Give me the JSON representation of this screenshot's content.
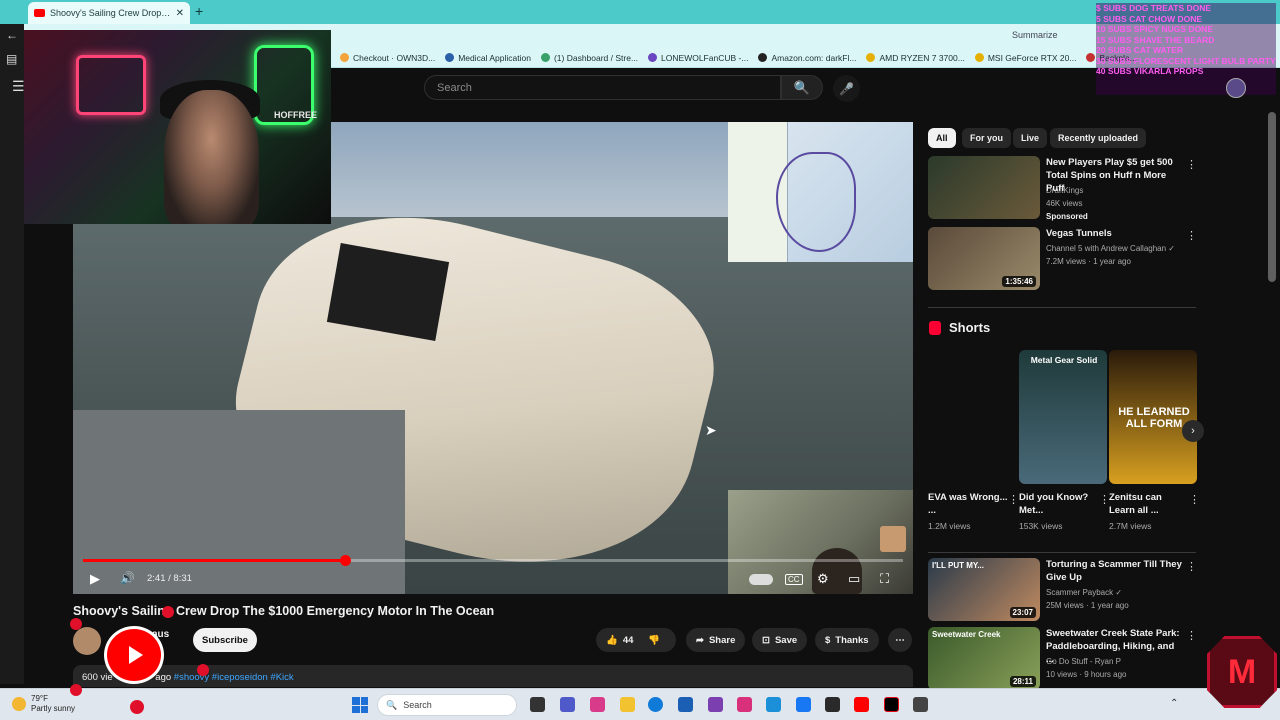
{
  "browser": {
    "active_tab_title": "Shoovy's Sailing Crew Drop The $",
    "active_tab_close": "✕",
    "new_tab": "+",
    "summarize": "Summarize",
    "bookmarks": [
      {
        "label": "Checkout · OWN3D...",
        "color": "#f2a33a"
      },
      {
        "label": "Medical Application",
        "color": "#2b5fa8"
      },
      {
        "label": "(1) Dashboard / Stre...",
        "color": "#38a169"
      },
      {
        "label": "LONEWOLFanCUB -...",
        "color": "#6b46c1"
      },
      {
        "label": "Amazon.com: darkFl...",
        "color": "#222222"
      },
      {
        "label": "AMD RYZEN 7 3700...",
        "color": "#e6b000"
      },
      {
        "label": "MSI GeForce RTX 20...",
        "color": "#e6b000"
      },
      {
        "label": "Backpla...",
        "color": "#c53030"
      }
    ]
  },
  "stream_overlay": {
    "webcam_label": "HOFFREE",
    "goals_text": "$ SUBS DOG TREATS DONE\n5 SUBS CAT CHOW DONE\n10 SUBS SPICY NUGS DONE\n15 SUBS SHAVE THE BEARD\n20 SUBS CAT WATER\n30 SUBS FLORESCENT LIGHT BULB PARTY\n40 SUBS VIKARLA PROPS",
    "corner_logo": "M"
  },
  "youtube": {
    "search_placeholder": "Search",
    "search_icon": "🔍",
    "mic_icon": "🎤",
    "menu_icon": "☰"
  },
  "player": {
    "time": "2:41 / 8:31",
    "progress": 0.32,
    "play_icon": "▶",
    "volume_icon": "🔊",
    "cc_label": "CC",
    "settings_icon": "⚙",
    "theater_icon": "▭",
    "fullscreen_icon": "⛶",
    "cursor": "➤"
  },
  "video": {
    "title": "Shoovy's Sailing Crew Drop The $1000 Emergency Motor In The Ocean",
    "channel": "aus",
    "subscribe": "Subscribe",
    "likes": "44",
    "share": "Share",
    "save": "Save",
    "thanks": "Thanks",
    "more": "⋯",
    "desc_prefix": "600 vie",
    "desc_ago": "ago",
    "desc_tags": "#shoovy #iceposeidon #Kick"
  },
  "chips": [
    "All",
    "For you",
    "Live",
    "Recently uploaded"
  ],
  "recommendations_top": [
    {
      "title": "New Players Play $5 get 500 Total Spins on Huff n More Puff",
      "line1": "DraftKings",
      "line2": "46K views",
      "line3": "Sponsored",
      "duration": "",
      "colors": [
        "#2b3a2b",
        "#6a5a3a"
      ]
    },
    {
      "title": "Vegas Tunnels",
      "line1": "Channel 5 with Andrew Callaghan ✓",
      "line2": "7.2M views · 1 year ago",
      "line3": "",
      "duration": "1:35:46",
      "colors": [
        "#5a4a3a",
        "#9a8a6a"
      ]
    }
  ],
  "shorts": {
    "header": "Shorts",
    "next": "›",
    "items": [
      {
        "title": "EVA was Wrong... ...",
        "views": "1.2M views",
        "overlay": "",
        "colors": [
          "#0f0f0f",
          "#0f0f0f"
        ]
      },
      {
        "title": "Did you Know? Met...",
        "views": "153K views",
        "overlay": "Metal Gear Solid",
        "colors": [
          "#1f3a3a",
          "#4a6a7a"
        ]
      },
      {
        "title": "Zenitsu can Learn all ...",
        "views": "2.7M views",
        "overlay": "HE LEARNED ALL FORM",
        "colors": [
          "#2a1a0a",
          "#d8a020"
        ]
      }
    ]
  },
  "recommendations_bottom": [
    {
      "title": "Torturing a Scammer Till They Give Up",
      "line1": "Scammer Payback ✓",
      "line2": "25M views · 1 year ago",
      "line3": "",
      "duration": "23:07",
      "overlay": "I'LL PUT MY...",
      "colors": [
        "#2a3a4a",
        "#c08a60"
      ]
    },
    {
      "title": "Sweetwater Creek State Park: Paddleboarding, Hiking, and ...",
      "line1": "Go Do Stuff - Ryan P",
      "line2": "10 views · 9 hours ago",
      "line3": "",
      "duration": "28:11",
      "overlay": "Sweetwater Creek",
      "colors": [
        "#3a5a2a",
        "#8aa05a"
      ]
    }
  ],
  "taskbar": {
    "temp": "79°F",
    "weather": "Partly sunny",
    "search": "Search"
  }
}
